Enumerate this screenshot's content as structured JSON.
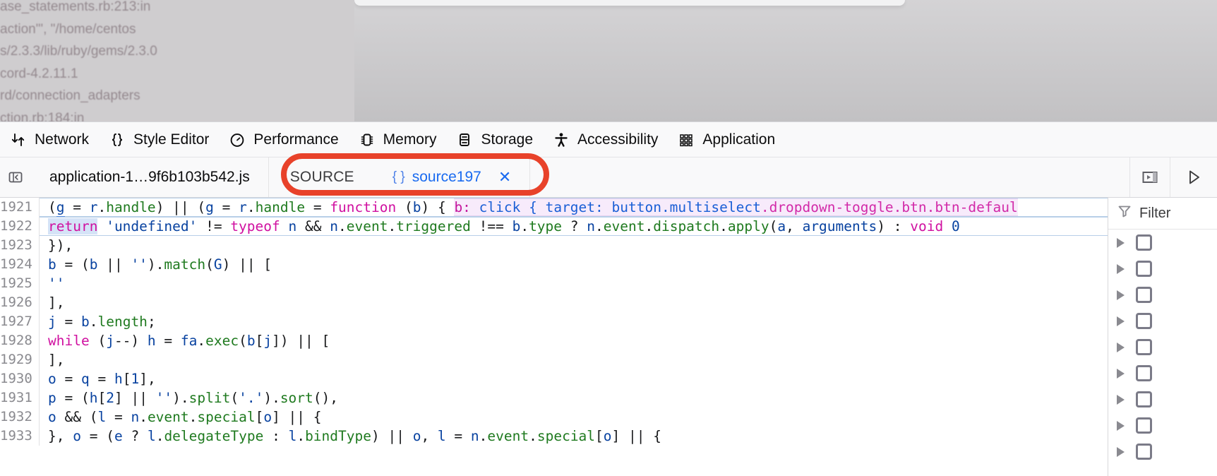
{
  "overlay": {
    "trace_lines": [
      "ase_statements.rb:213:in",
      "action\"', \"/home/centos",
      "s/2.3.3/lib/ruby/gems/2.3.0",
      "cord-4.2.11.1",
      "rd/connection_adapters",
      "ction.rb:184:in"
    ]
  },
  "toolbar": {
    "tabs": [
      {
        "label": "Network",
        "icon": "network-arrows-icon"
      },
      {
        "label": "Style Editor",
        "icon": "braces-icon"
      },
      {
        "label": "Performance",
        "icon": "stopwatch-icon"
      },
      {
        "label": "Memory",
        "icon": "memory-chip-icon"
      },
      {
        "label": "Storage",
        "icon": "database-icon"
      },
      {
        "label": "Accessibility",
        "icon": "person-icon"
      },
      {
        "label": "Application",
        "icon": "grid-squares-icon"
      }
    ]
  },
  "source_tabs": {
    "pane_toggle_icon": "panel-collapse-icon",
    "file_tab": "application-1…9f6b103b542.js",
    "source_label": "SOURCE",
    "source_braces": "{ }",
    "source_name": "source197",
    "close_label": "✕",
    "buttons": [
      {
        "name": "split-console-button",
        "icon": "split-console-icon"
      },
      {
        "name": "resume-button",
        "icon": "play-triangle-icon"
      }
    ]
  },
  "editor": {
    "lines": [
      {
        "number": "1921",
        "paused": true,
        "tokens": [
          {
            "t": "        ",
            "c": "t-punc"
          },
          {
            "t": "(",
            "c": "t-punc"
          },
          {
            "t": "g",
            "c": "t-ident ident-underline"
          },
          {
            "t": " = ",
            "c": "t-op"
          },
          {
            "t": "r",
            "c": "t-ident"
          },
          {
            "t": ".",
            "c": "t-punc"
          },
          {
            "t": "handle",
            "c": "t-prop"
          },
          {
            "t": ") || (",
            "c": "t-punc"
          },
          {
            "t": "g",
            "c": "t-ident"
          },
          {
            "t": " = ",
            "c": "t-op"
          },
          {
            "t": "r",
            "c": "t-ident"
          },
          {
            "t": ".",
            "c": "t-punc"
          },
          {
            "t": "handle",
            "c": "t-prop"
          },
          {
            "t": " = ",
            "c": "t-op"
          },
          {
            "t": "function",
            "c": "t-kw"
          },
          {
            "t": " (",
            "c": "t-punc"
          },
          {
            "t": "b",
            "c": "t-ident"
          },
          {
            "t": ") { ",
            "c": "t-punc"
          }
        ],
        "preview": {
          "key": "b:",
          "value": " click { target: button.multiselect",
          "tail": ".dropdown-toggle.btn.btn-defaul"
        }
      },
      {
        "number": "1922",
        "paused": true,
        "tokens": [
          {
            "t": "          ",
            "c": "t-punc"
          },
          {
            "t": "return",
            "c": "t-kw sel-hl"
          },
          {
            "t": " ",
            "c": "t-punc"
          },
          {
            "t": "'undefined'",
            "c": "t-str"
          },
          {
            "t": " != ",
            "c": "t-op"
          },
          {
            "t": "typeof",
            "c": "t-kw"
          },
          {
            "t": " ",
            "c": "t-punc"
          },
          {
            "t": "n",
            "c": "t-ident"
          },
          {
            "t": " && ",
            "c": "t-op"
          },
          {
            "t": "n",
            "c": "t-ident"
          },
          {
            "t": ".",
            "c": "t-punc"
          },
          {
            "t": "event",
            "c": "t-prop"
          },
          {
            "t": ".",
            "c": "t-punc"
          },
          {
            "t": "triggered",
            "c": "t-prop"
          },
          {
            "t": " !== ",
            "c": "t-op"
          },
          {
            "t": "b",
            "c": "t-ident"
          },
          {
            "t": ".",
            "c": "t-punc"
          },
          {
            "t": "type",
            "c": "t-prop"
          },
          {
            "t": " ? ",
            "c": "t-punc"
          },
          {
            "t": "n",
            "c": "t-ident"
          },
          {
            "t": ".",
            "c": "t-punc"
          },
          {
            "t": "event",
            "c": "t-prop"
          },
          {
            "t": ".",
            "c": "t-punc"
          },
          {
            "t": "dispatch",
            "c": "t-prop"
          },
          {
            "t": ".",
            "c": "t-punc"
          },
          {
            "t": "apply",
            "c": "t-prop"
          },
          {
            "t": "(",
            "c": "t-punc"
          },
          {
            "t": "a",
            "c": "t-ident"
          },
          {
            "t": ", ",
            "c": "t-punc"
          },
          {
            "t": "arguments",
            "c": "t-ident"
          },
          {
            "t": ") : ",
            "c": "t-punc"
          },
          {
            "t": "void",
            "c": "t-kw"
          },
          {
            "t": " ",
            "c": "t-punc"
          },
          {
            "t": "0",
            "c": "t-num"
          }
        ]
      },
      {
        "number": "1923",
        "paused": false,
        "tokens": [
          {
            "t": "        ",
            "c": "t-punc"
          },
          {
            "t": "}),",
            "c": "t-punc"
          }
        ]
      },
      {
        "number": "1924",
        "paused": false,
        "tokens": [
          {
            "t": "        ",
            "c": "t-punc"
          },
          {
            "t": "b",
            "c": "t-ident"
          },
          {
            "t": " = (",
            "c": "t-punc"
          },
          {
            "t": "b",
            "c": "t-ident"
          },
          {
            "t": " || ",
            "c": "t-op"
          },
          {
            "t": "''",
            "c": "t-str"
          },
          {
            "t": ").",
            "c": "t-punc"
          },
          {
            "t": "match",
            "c": "t-prop"
          },
          {
            "t": "(",
            "c": "t-punc"
          },
          {
            "t": "G",
            "c": "t-ident"
          },
          {
            "t": ") || [",
            "c": "t-punc"
          }
        ]
      },
      {
        "number": "1925",
        "paused": false,
        "tokens": [
          {
            "t": "          ",
            "c": "t-punc"
          },
          {
            "t": "''",
            "c": "t-str"
          }
        ]
      },
      {
        "number": "1926",
        "paused": false,
        "tokens": [
          {
            "t": "        ",
            "c": "t-punc"
          },
          {
            "t": "],",
            "c": "t-punc"
          }
        ]
      },
      {
        "number": "1927",
        "paused": false,
        "tokens": [
          {
            "t": "        ",
            "c": "t-punc"
          },
          {
            "t": "j",
            "c": "t-ident"
          },
          {
            "t": " = ",
            "c": "t-op"
          },
          {
            "t": "b",
            "c": "t-ident"
          },
          {
            "t": ".",
            "c": "t-punc"
          },
          {
            "t": "length",
            "c": "t-prop"
          },
          {
            "t": ";",
            "c": "t-punc"
          }
        ]
      },
      {
        "number": "1928",
        "paused": false,
        "tokens": [
          {
            "t": "        ",
            "c": "t-punc"
          },
          {
            "t": "while",
            "c": "t-kw"
          },
          {
            "t": " (",
            "c": "t-punc"
          },
          {
            "t": "j",
            "c": "t-ident"
          },
          {
            "t": "--) ",
            "c": "t-punc"
          },
          {
            "t": "h",
            "c": "t-ident"
          },
          {
            "t": " = ",
            "c": "t-op"
          },
          {
            "t": "fa",
            "c": "t-ident"
          },
          {
            "t": ".",
            "c": "t-punc"
          },
          {
            "t": "exec",
            "c": "t-prop"
          },
          {
            "t": "(",
            "c": "t-punc"
          },
          {
            "t": "b",
            "c": "t-ident"
          },
          {
            "t": "[",
            "c": "t-punc"
          },
          {
            "t": "j",
            "c": "t-ident"
          },
          {
            "t": "]) || [",
            "c": "t-punc"
          }
        ]
      },
      {
        "number": "1929",
        "paused": false,
        "tokens": [
          {
            "t": "        ",
            "c": "t-punc"
          },
          {
            "t": "],",
            "c": "t-punc"
          }
        ]
      },
      {
        "number": "1930",
        "paused": false,
        "tokens": [
          {
            "t": "        ",
            "c": "t-punc"
          },
          {
            "t": "o",
            "c": "t-ident"
          },
          {
            "t": " = ",
            "c": "t-op"
          },
          {
            "t": "q",
            "c": "t-ident"
          },
          {
            "t": " = ",
            "c": "t-op"
          },
          {
            "t": "h",
            "c": "t-ident"
          },
          {
            "t": "[",
            "c": "t-punc"
          },
          {
            "t": "1",
            "c": "t-num"
          },
          {
            "t": "],",
            "c": "t-punc"
          }
        ]
      },
      {
        "number": "1931",
        "paused": false,
        "tokens": [
          {
            "t": "        ",
            "c": "t-punc"
          },
          {
            "t": "p",
            "c": "t-ident"
          },
          {
            "t": " = (",
            "c": "t-punc"
          },
          {
            "t": "h",
            "c": "t-ident"
          },
          {
            "t": "[",
            "c": "t-punc"
          },
          {
            "t": "2",
            "c": "t-num"
          },
          {
            "t": "] || ",
            "c": "t-punc"
          },
          {
            "t": "''",
            "c": "t-str"
          },
          {
            "t": ").",
            "c": "t-punc"
          },
          {
            "t": "split",
            "c": "t-prop"
          },
          {
            "t": "(",
            "c": "t-punc"
          },
          {
            "t": "'.'",
            "c": "t-str"
          },
          {
            "t": ").",
            "c": "t-punc"
          },
          {
            "t": "sort",
            "c": "t-prop"
          },
          {
            "t": "(),",
            "c": "t-punc"
          }
        ]
      },
      {
        "number": "1932",
        "paused": false,
        "tokens": [
          {
            "t": "        ",
            "c": "t-punc"
          },
          {
            "t": "o",
            "c": "t-ident"
          },
          {
            "t": " && (",
            "c": "t-punc"
          },
          {
            "t": "l",
            "c": "t-ident"
          },
          {
            "t": " = ",
            "c": "t-op"
          },
          {
            "t": "n",
            "c": "t-ident"
          },
          {
            "t": ".",
            "c": "t-punc"
          },
          {
            "t": "event",
            "c": "t-prop"
          },
          {
            "t": ".",
            "c": "t-punc"
          },
          {
            "t": "special",
            "c": "t-prop"
          },
          {
            "t": "[",
            "c": "t-punc"
          },
          {
            "t": "o",
            "c": "t-ident"
          },
          {
            "t": "] || {",
            "c": "t-punc"
          }
        ]
      },
      {
        "number": "1933",
        "paused": false,
        "tokens": [
          {
            "t": "        ",
            "c": "t-punc"
          },
          {
            "t": "}, ",
            "c": "t-punc"
          },
          {
            "t": "o",
            "c": "t-ident"
          },
          {
            "t": " = (",
            "c": "t-punc"
          },
          {
            "t": "e",
            "c": "t-ident"
          },
          {
            "t": " ? ",
            "c": "t-punc"
          },
          {
            "t": "l",
            "c": "t-ident"
          },
          {
            "t": ".",
            "c": "t-punc"
          },
          {
            "t": "delegateType",
            "c": "t-prop"
          },
          {
            "t": " : ",
            "c": "t-punc"
          },
          {
            "t": "l",
            "c": "t-ident"
          },
          {
            "t": ".",
            "c": "t-punc"
          },
          {
            "t": "bindType",
            "c": "t-prop"
          },
          {
            "t": ") || ",
            "c": "t-punc"
          },
          {
            "t": "o",
            "c": "t-ident"
          },
          {
            "t": ", ",
            "c": "t-punc"
          },
          {
            "t": "l",
            "c": "t-ident"
          },
          {
            "t": " = ",
            "c": "t-op"
          },
          {
            "t": "n",
            "c": "t-ident"
          },
          {
            "t": ".",
            "c": "t-punc"
          },
          {
            "t": "event",
            "c": "t-prop"
          },
          {
            "t": ".",
            "c": "t-punc"
          },
          {
            "t": "special",
            "c": "t-prop"
          },
          {
            "t": "[",
            "c": "t-punc"
          },
          {
            "t": "o",
            "c": "t-ident"
          },
          {
            "t": "] || {",
            "c": "t-punc"
          }
        ]
      }
    ]
  },
  "sidebar": {
    "filter_label": "Filter",
    "filter_icon": "funnel-icon",
    "rows": [
      {
        "label": ""
      },
      {
        "label": ""
      },
      {
        "label": ""
      },
      {
        "label": ""
      },
      {
        "label": ""
      },
      {
        "label": ""
      },
      {
        "label": ""
      },
      {
        "label": ""
      },
      {
        "label": ""
      }
    ]
  },
  "colors": {
    "annotation": "#e8422a",
    "link": "#1a6bf0",
    "preview_bg": "#f7ebfb"
  }
}
